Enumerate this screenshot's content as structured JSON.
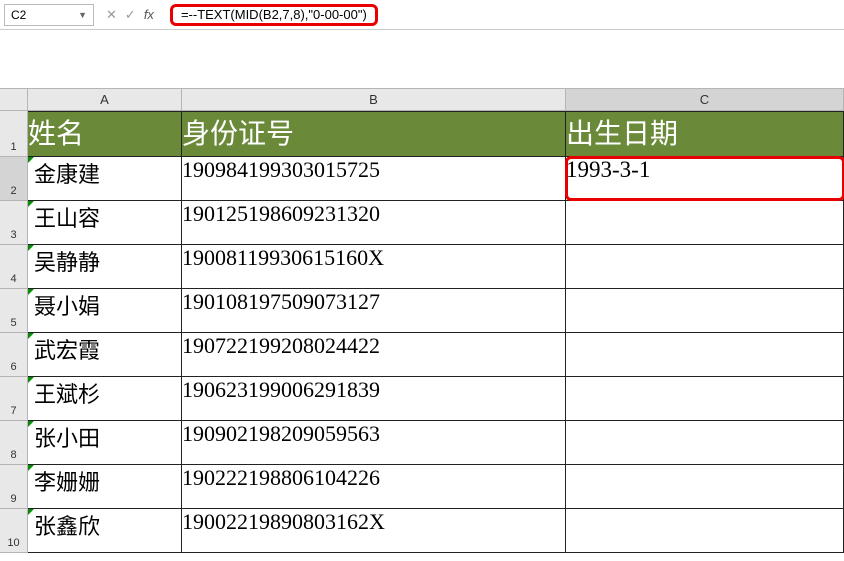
{
  "name_box": "C2",
  "fx_label": "fx",
  "formula": "=--TEXT(MID(B2,7,8),\"0-00-00\")",
  "columns": {
    "a": "A",
    "b": "B",
    "c": "C"
  },
  "rows": [
    "1",
    "2",
    "3",
    "4",
    "5",
    "6",
    "7",
    "8",
    "9",
    "10"
  ],
  "headers": {
    "name": "姓名",
    "id": "身份证号",
    "date": "出生日期"
  },
  "data": [
    {
      "name": "金康建",
      "id": "190984199303015725",
      "date": "1993-3-1"
    },
    {
      "name": "王山容",
      "id": "190125198609231320",
      "date": ""
    },
    {
      "name": "吴静静",
      "id": "19008119930615160X",
      "date": ""
    },
    {
      "name": "聂小娟",
      "id": "190108197509073127",
      "date": ""
    },
    {
      "name": "武宏霞",
      "id": "190722199208024422",
      "date": ""
    },
    {
      "name": "王斌杉",
      "id": "190623199006291839",
      "date": ""
    },
    {
      "name": "张小田",
      "id": "190902198209059563",
      "date": ""
    },
    {
      "name": "李姗姗",
      "id": "190222198806104226",
      "date": ""
    },
    {
      "name": "张鑫欣",
      "id": "19002219890803162X",
      "date": ""
    }
  ],
  "icons": {
    "cancel": "✕",
    "confirm": "✓"
  }
}
